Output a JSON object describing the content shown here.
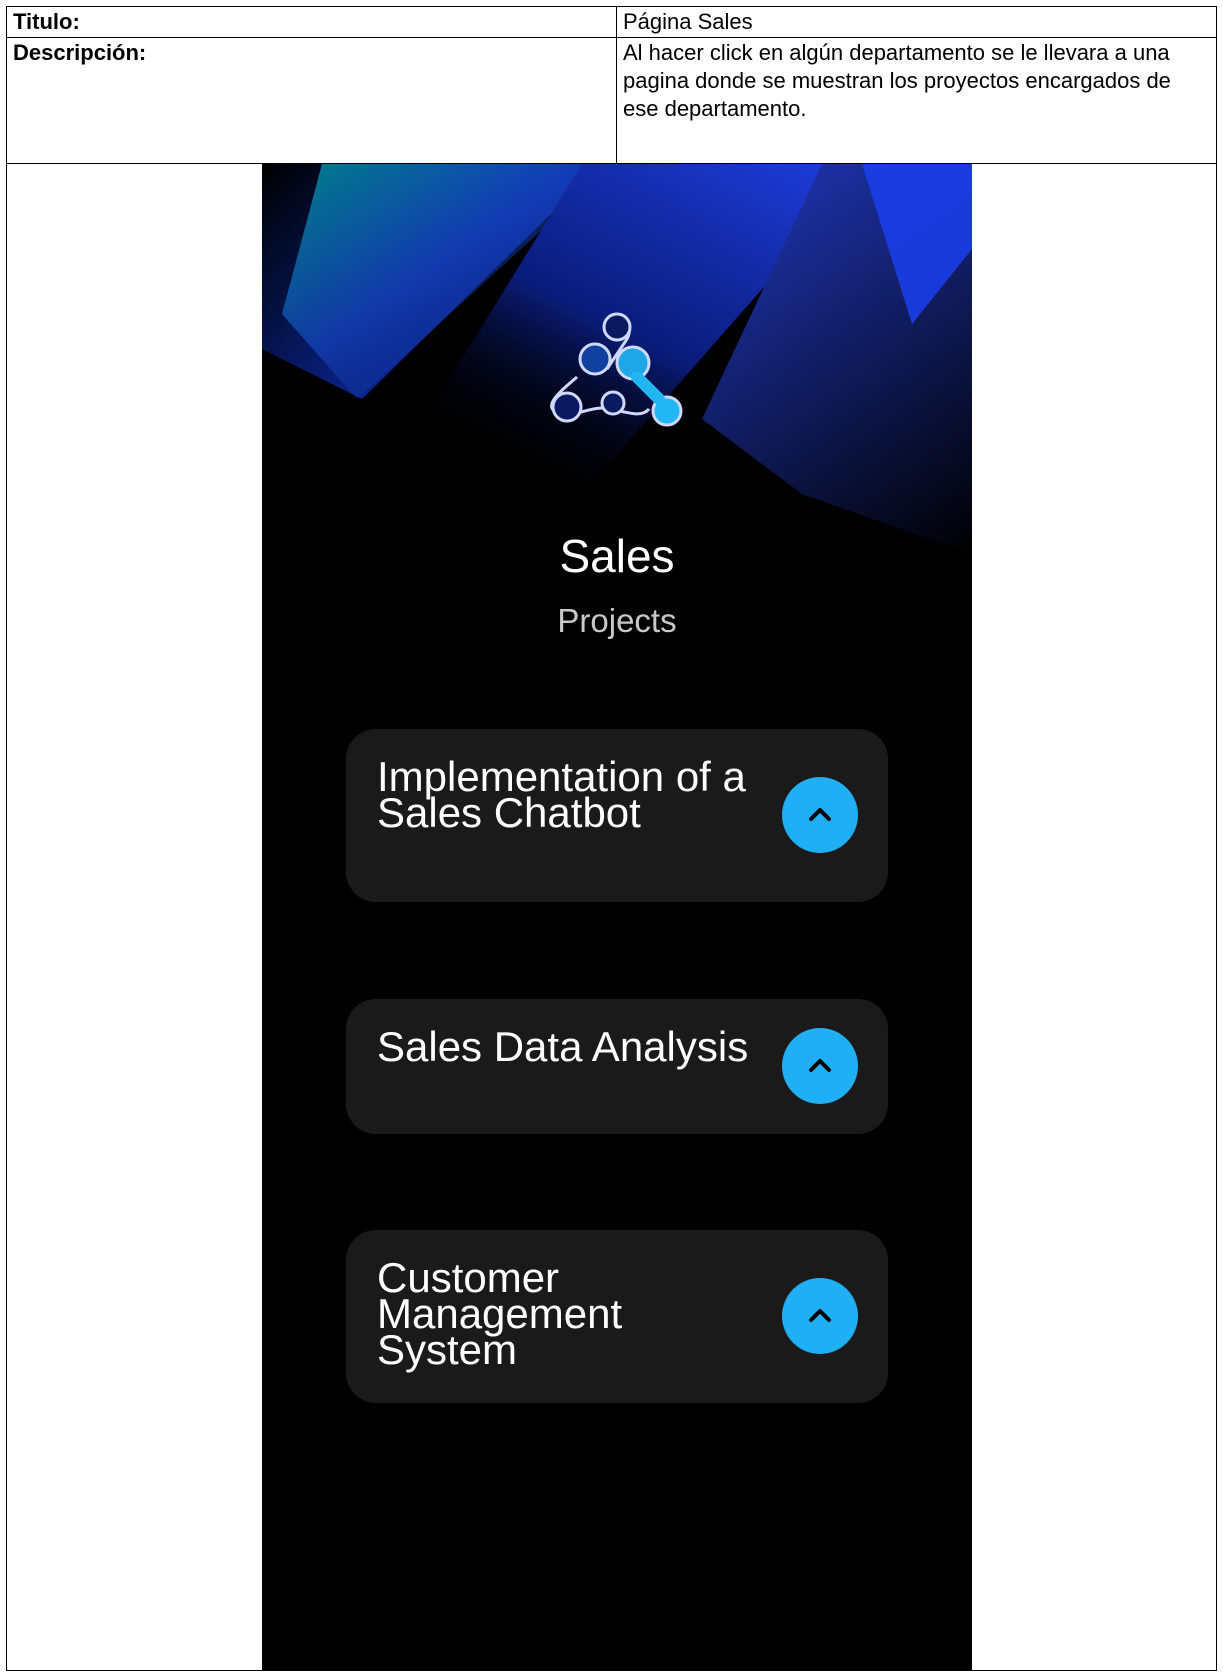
{
  "spec": {
    "title_label": "Titulo:",
    "title_value": "Página Sales",
    "description_label": "Descripción:",
    "description_value": "Al hacer click en algún departamento se le llevara a una pagina donde se muestran los proyectos encargados de ese departamento."
  },
  "screen": {
    "heading": "Sales",
    "subheading": "Projects",
    "logo_icon": "molecule-logo-icon",
    "accent_color": "#20aef5",
    "card_color": "#1a1a1a",
    "projects": [
      {
        "label": "Implementation of a Sales Chatbot",
        "button_icon": "chevron-up-icon"
      },
      {
        "label": "Sales Data Analysis",
        "button_icon": "chevron-up-icon"
      },
      {
        "label": "Customer Management System",
        "button_icon": "chevron-up-icon"
      }
    ]
  }
}
